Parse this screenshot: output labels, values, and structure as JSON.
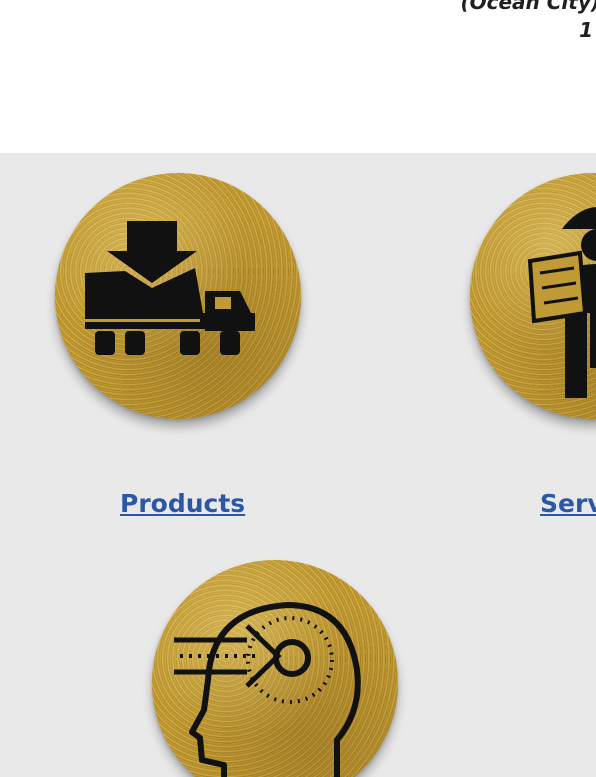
{
  "header": {
    "location": "(Ocean City)",
    "number": "1"
  },
  "cards": [
    {
      "label": "Products",
      "icon": "dump-truck-icon"
    },
    {
      "label": "Services",
      "icon": "engineer-blueprint-icon"
    },
    {
      "label": "",
      "icon": "head-target-icon"
    }
  ],
  "colors": {
    "link": "#2a57a6",
    "panel_bg": "#e9e9ea",
    "gold": "#bf9a35",
    "icon": "#111111"
  }
}
